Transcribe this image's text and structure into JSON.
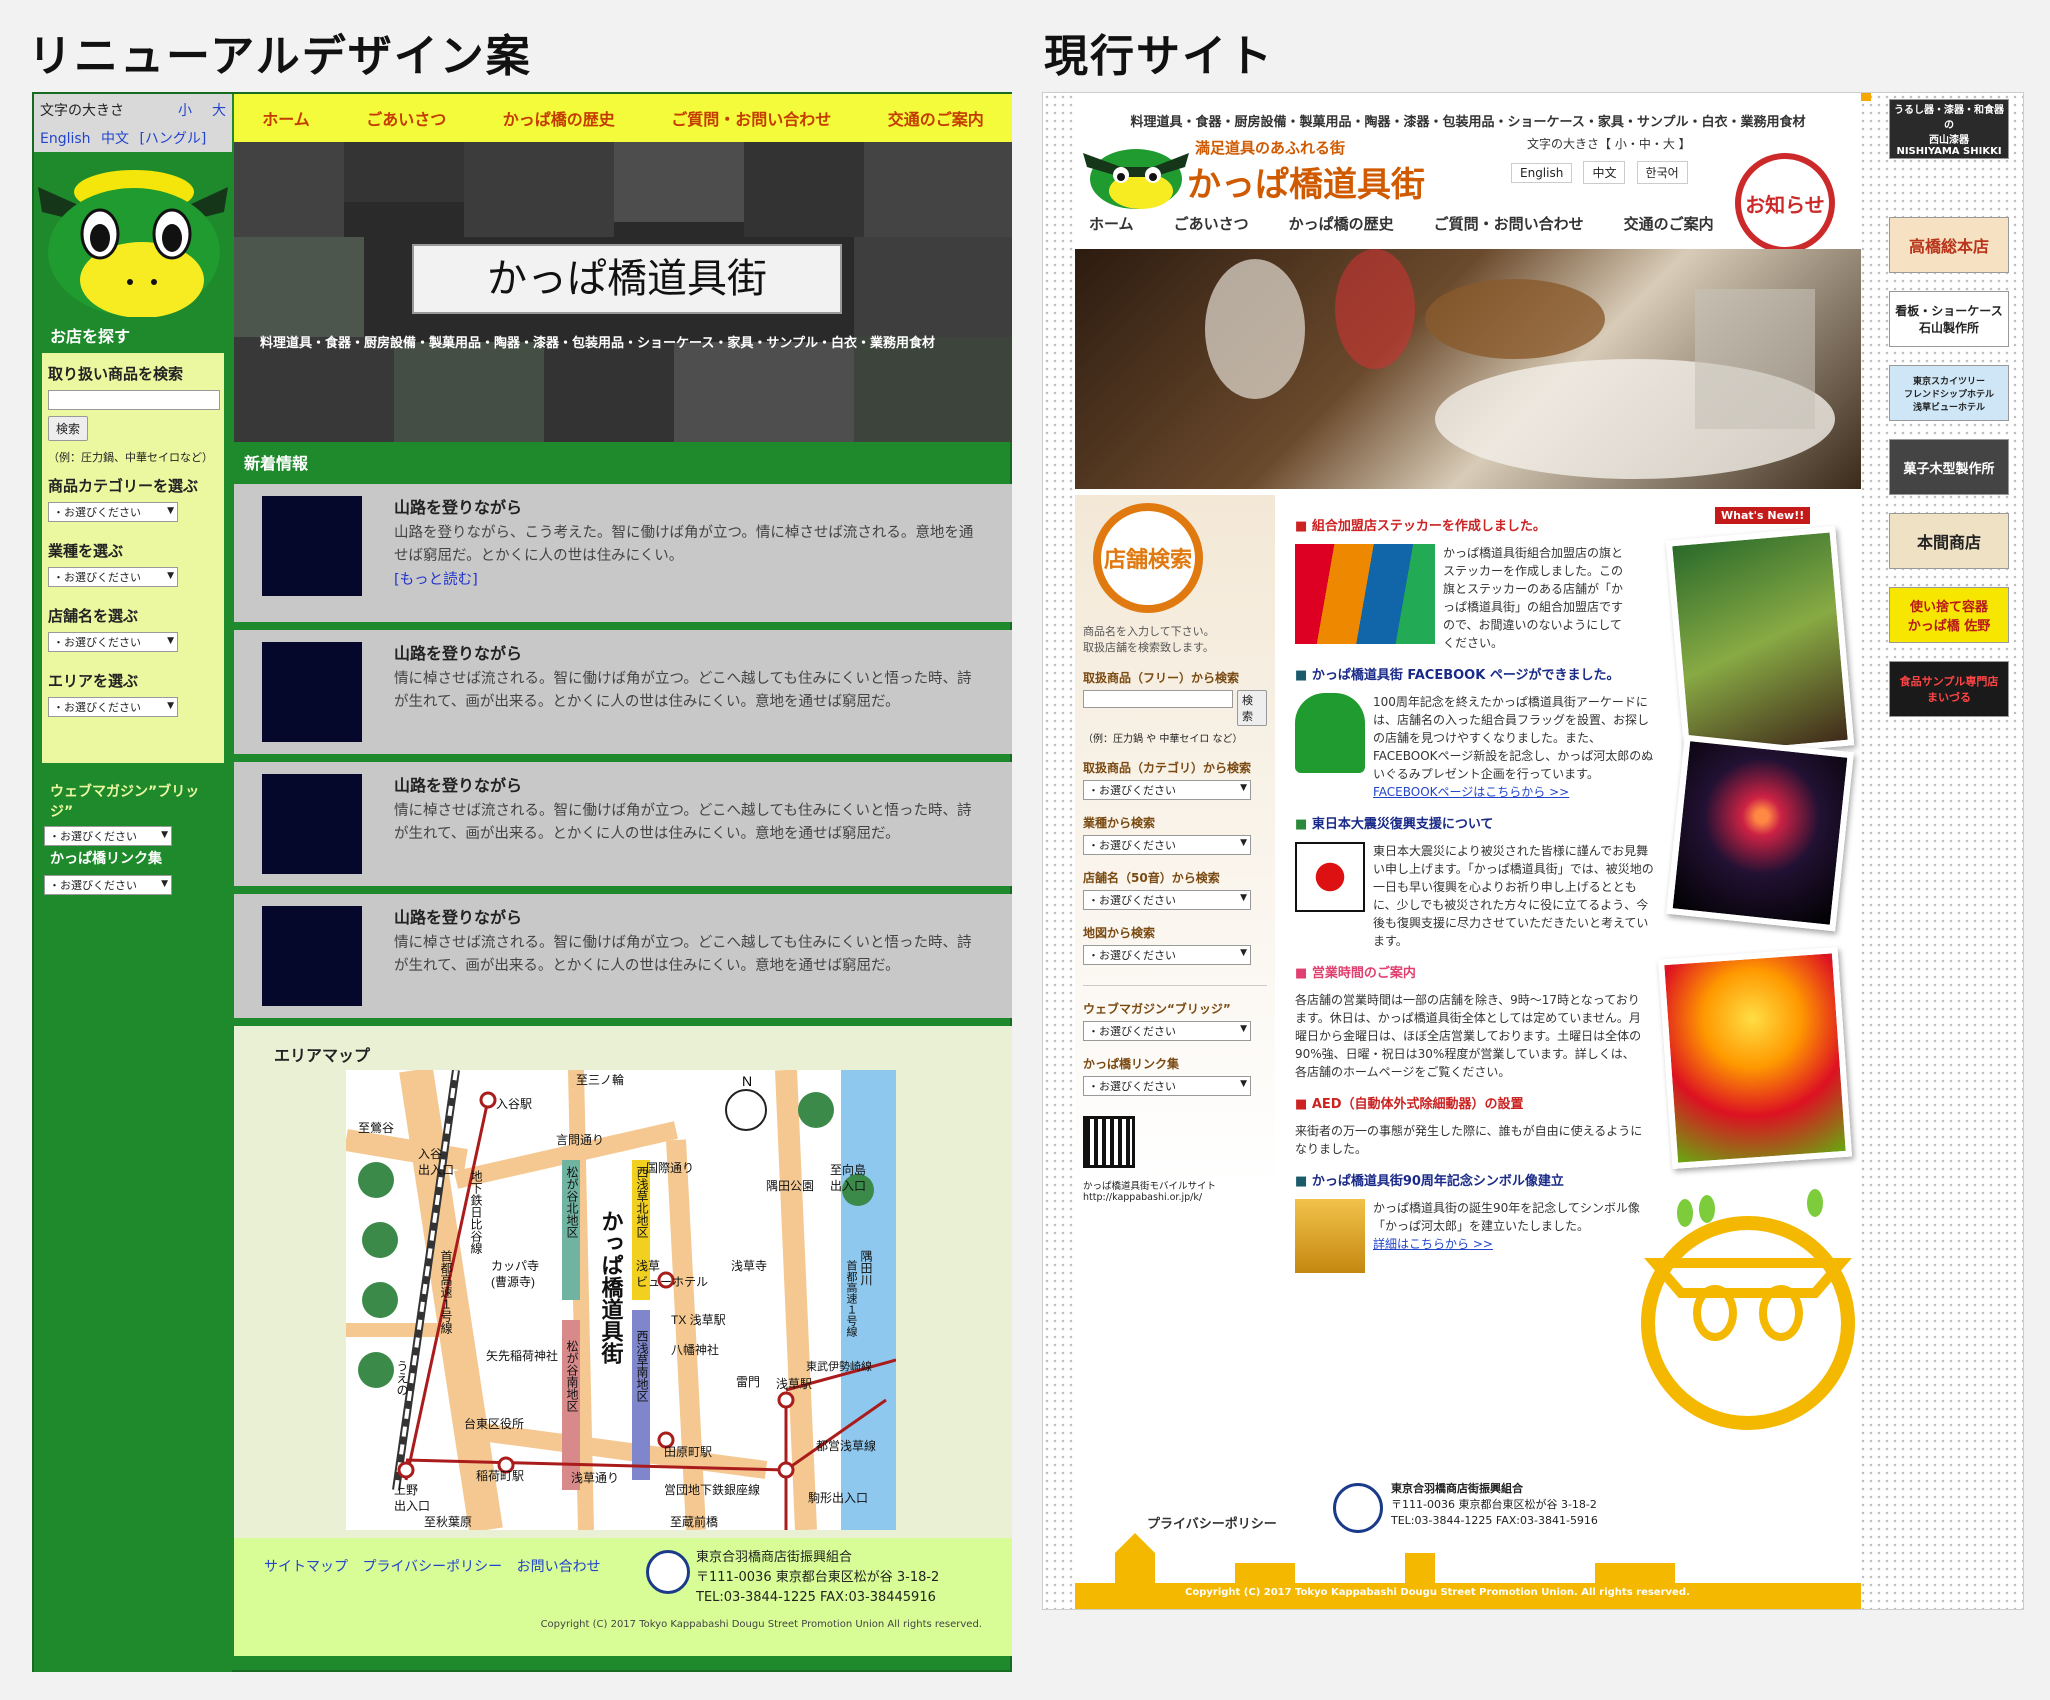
{
  "headings": {
    "renewal": "リニューアルデザイン案",
    "current": "現行サイト"
  },
  "left": {
    "font_size": {
      "label": "文字の大きさ",
      "small": "小",
      "large": "大"
    },
    "langs": [
      "English",
      "中文",
      "[ハングル]"
    ],
    "sidebar": {
      "heading": "お店を探す",
      "search_label": "取り扱い商品を検索",
      "search_button": "検索",
      "example": "（例：圧力鍋、中華セイロなど）",
      "groups": [
        {
          "label": "商品カテゴリーを選ぶ",
          "placeholder": "・お選びください"
        },
        {
          "label": "業種を選ぶ",
          "placeholder": "・お選びください"
        },
        {
          "label": "店舗名を選ぶ",
          "placeholder": "・お選びください"
        },
        {
          "label": "エリアを選ぶ",
          "placeholder": "・お選びください"
        }
      ],
      "magazine": "ウェブマガジン”ブリッジ”",
      "magazine_select": "・お選びください",
      "links_label": "かっぱ橋リンク集",
      "links_select": "・お選びください"
    },
    "nav": [
      "ホーム",
      "ごあいさつ",
      "かっぱ橋の歴史",
      "ご質問・お問い合わせ",
      "交通のご案内"
    ],
    "hero": {
      "title": "かっぱ橋道具街",
      "subtitle": "料理道具・食器・厨房設備・製菓用品・陶器・漆器・包装用品・ショーケース・家具・サンプル・白衣・業務用食材"
    },
    "news_heading": "新着情報",
    "news": [
      {
        "title": "山路を登りながら",
        "body": "山路を登りながら、こう考えた。智に働けば角が立つ。情に棹させば流される。意地を通せば窮屈だ。とかくに人の世は住みにくい。",
        "more": "[もっと読む]"
      },
      {
        "title": "山路を登りながら",
        "body": "情に棹させば流される。智に働けば角が立つ。どこへ越しても住みにくいと悟った時、詩が生れて、画が出来る。とかくに人の世は住みにくい。意地を通せば窮屈だ。"
      },
      {
        "title": "山路を登りながら",
        "body": "情に棹させば流される。智に働けば角が立つ。どこへ越しても住みにくいと悟った時、詩が生れて、画が出来る。とかくに人の世は住みにくい。意地を通せば窮屈だ。"
      },
      {
        "title": "山路を登りながら",
        "body": "情に棹させば流される。智に働けば角が立つ。どこへ越しても住みにくいと悟った時、詩が生れて、画が出来る。とかくに人の世は住みにくい。意地を通せば窮屈だ。"
      }
    ],
    "map": {
      "title": "エリアマップ",
      "labels": {
        "sanno": "至三ノ輪",
        "iriya": "入谷駅",
        "uguisu": "至鶯谷",
        "iriya_exit": "入谷\n出入口",
        "kototoi": "言問通り",
        "kitachi": "松が谷北地区",
        "nishi_kita": "西浅草北地区",
        "kokusai": "国際通り",
        "kappa": "かっぱ橋道具街",
        "asakusa_view": "浅草\nビューホテル",
        "asakusadera": "浅草寺",
        "kappadera": "カッパ寺\n(曹源寺)",
        "tx": "TX 浅草駅",
        "hachiman": "八幡神社",
        "yanagi": "矢先稲荷神社",
        "minami": "松が谷南地区",
        "nishi_minami": "西浅草南地区",
        "kaminari": "雷門",
        "asakusa_st": "浅草駅",
        "tobu": "東武伊勢崎線",
        "ward": "台東区役所",
        "inari": "稲荷町駅",
        "tawara": "田原町駅",
        "asakusa_dori": "浅草通り",
        "ginza": "営団地下鉄銀座線",
        "toei": "都営浅草線",
        "ueno": "上野\n出入口",
        "akiba": "至秋葉原",
        "komakata": "駒形出入口",
        "kuramae": "至蔵前橋",
        "sumida_park": "隅田公園",
        "mukojima": "至向島\n出入口",
        "sumida": "隅田川",
        "shuto": "首都高速１号線",
        "hibiya": "地下鉄日比谷線",
        "ueno_line": "うえの",
        "shuto_l": "首都高速１号線",
        "n": "N"
      }
    },
    "footer": {
      "links": [
        "サイトマップ",
        "プライバシーポリシー",
        "お問い合わせ"
      ],
      "org": "東京合羽橋商店街振興組合",
      "addr": "〒111-0036 東京都台東区松が谷 3-18-2",
      "tel": "TEL:03-3844-1225 FAX:03-38445916",
      "copyright": "Copyright (C) 2017 Tokyo Kappabashi Dougu Street Promotion Union All rights reserved."
    }
  },
  "right": {
    "top_text": "料理道具・食器・厨房設備・製菓用品・陶器・漆器・包装用品・ショーケース・家具・サンプル・白衣・業務用食材",
    "logo_sub": "満足道具のあふれる街",
    "logo_title": "かっぱ橋道具街",
    "font_size": "文字の大きさ【 小・中・大 】",
    "langs": [
      "English",
      "中文",
      "한국어"
    ],
    "notice": "お知らせ",
    "nav": [
      "ホーム",
      "ごあいさつ",
      "かっぱ橋の歴史",
      "ご質問・お問い合わせ",
      "交通のご案内"
    ],
    "search": {
      "title": "店舗検索",
      "intro": "商品名を入力して下さい。\n取扱店舗を検索致します。",
      "free_label": "取扱商品（フリー）から検索",
      "button": "検索",
      "example": "（例：圧力鍋 や 中華セイロ など）",
      "groups": [
        {
          "label": "取扱商品（カテゴリ）から検索",
          "placeholder": "・お選びください"
        },
        {
          "label": "業種から検索",
          "placeholder": "・お選びください"
        },
        {
          "label": "店舗名（50音）から検索",
          "placeholder": "・お選びください"
        },
        {
          "label": "地図から検索",
          "placeholder": "・お選びください"
        }
      ],
      "magazine": "ウェブマガジン“ブリッジ”",
      "magazine_select": "・お選びください",
      "links_label": "かっぱ橋リンク集",
      "links_select": "・お選びください",
      "mobile": "かっぱ橋道具街モバイルサイト",
      "mobile_url": "http://kappabashi.or.jp/k/"
    },
    "whats_new": "What's New!!",
    "news": [
      {
        "title": "組合加盟店ステッカーを作成しました。",
        "body": "かっぱ橋道具街組合加盟店の旗とステッカーを作成しました。この旗とステッカーのある店舗が「かっぱ橋道具街」の組合加盟店ですので、お間違いのないようにしてください。"
      },
      {
        "title": "かっぱ橋道具街 FACEBOOK ページができました。",
        "body": "100周年記念を終えたかっぱ橋道具街アーケードには、店舗名の入った組合員フラッグを設置、お探しの店舗を見つけやすくなりました。また、FACEBOOKページ新設を記念し、かっぱ河太郎のぬいぐるみプレゼント企画を行っています。",
        "link": "FACEBOOKページはこちらから >>"
      },
      {
        "title": "東日本大震災復興支援について",
        "body": "東日本大震災により被災された皆様に謹んでお見舞い申し上げます。「かっぱ橋道具街」では、被災地の一日も早い復興を心よりお祈り申し上げるとともに、少しでも被災された方々に役に立てるよう、今後も復興支援に尽力させていただきたいと考えています。"
      },
      {
        "title": "営業時間のご案内",
        "body": "各店舗の営業時間は一部の店舗を除き、9時〜17時となっております。休日は、かっぱ橋道具街全体としては定めていません。月曜日から金曜日は、ほぼ全店営業しております。土曜日は全体の90%強、日曜・祝日は30%程度が営業しています。詳しくは、各店舗のホームページをご覧ください。"
      },
      {
        "title": "AED（自動体外式除細動器）の設置",
        "body": "来街者の万一の事態が発生した際に、誰もが自由に使えるようになりました。"
      },
      {
        "title": "かっぱ橋道具街90周年記念シンボル像建立",
        "body": "かっぱ橋道具街の誕生90年を記念してシンボル像「かっぱ河太郎」を建立いたしました。",
        "link": "詳細はこちらから >>"
      }
    ],
    "footer": {
      "privacy": "プライバシーポリシー",
      "org": "東京合羽橋商店街振興組合",
      "addr": "〒111-0036  東京都台東区松が谷 3-18-2",
      "tel": "TEL:03-3844-1225  FAX:03-3841-5916",
      "copyright": "Copyright (C) 2017 Tokyo Kappabashi Dougu Street Promotion Union. All rights reserved."
    },
    "ads": [
      "うるし器・漆器・和食器の\n西山漆器\nNISHIYAMA SHIKKI",
      "高橋総本店",
      "看板・ショーケース\n石山製作所",
      "東京スカイツリー\nフレンドシップホテル\n浅草ビューホテル",
      "菓子木型製作所",
      "本間商店",
      "使い捨て容器\nかっぱ橋 佐野",
      "食品サンプル専門店\nまいづる"
    ]
  },
  "colors": {
    "green": "#1e8a2c",
    "yellow": "#f4fb3a",
    "orange": "#f5a800"
  }
}
